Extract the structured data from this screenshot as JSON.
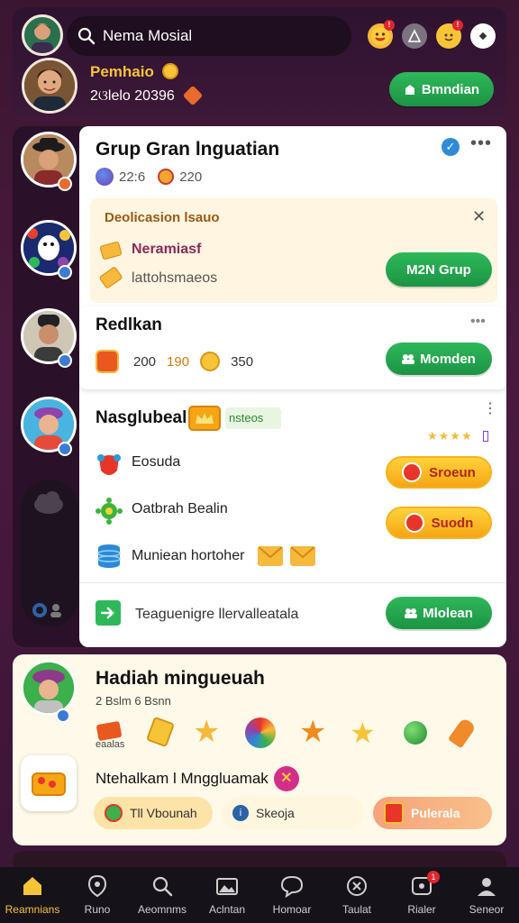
{
  "header": {
    "search_text": "Nema Mosial",
    "profile_name": "Pemhaio",
    "profile_stats": "2ଓlelo 20396",
    "button_label": "Bmndian"
  },
  "group": {
    "title": "Grup Gran lnguatian",
    "stats_a": "22:6",
    "stats_b": "220",
    "notice": {
      "title": "Deolicasion lsauo",
      "item1": "Neramiasf",
      "item2": "lattohsmaeos",
      "button": "M2N Grup"
    },
    "redeem": {
      "title": "Redlkan",
      "val_a": "200",
      "val_b": "190",
      "val_c": "350",
      "button": "Momden"
    },
    "section": {
      "title": "Nasglubeal",
      "tag": "nsteos",
      "items": [
        {
          "label": "Eosuda",
          "button": "Sroeun"
        },
        {
          "label": "Oatbrah Bealin",
          "button": "Suodn"
        },
        {
          "label": "Muniean hortoher"
        }
      ],
      "footer_text": "Teaguenigre llervalleatala",
      "footer_button": "Mlolean"
    }
  },
  "reward": {
    "title": "Hadiah mingueuah",
    "subtitle": "2 Bslm 6 Bsnn",
    "item_label": "eaalas",
    "promo_text": "Ntehalkam l Mnggluamak",
    "pills": [
      "Tll Vbounah",
      "Skeoja",
      "Pulerala"
    ]
  },
  "nav": [
    {
      "label": "Reamnians",
      "icon": "home-icon",
      "active": true
    },
    {
      "label": "Runo",
      "icon": "location-icon"
    },
    {
      "label": "Aeomnms",
      "icon": "search-icon"
    },
    {
      "label": "Aclntan",
      "icon": "mountain-icon"
    },
    {
      "label": "Homoar",
      "icon": "chat-icon"
    },
    {
      "label": "Taulat",
      "icon": "scan-icon"
    },
    {
      "label": "Rialer",
      "icon": "message-icon",
      "badge": "1"
    },
    {
      "label": "Seneor",
      "icon": "profile-icon"
    }
  ],
  "colors": {
    "accent": "#f6c437",
    "green": "#1b9444",
    "orange": "#f6a515",
    "bg": "#3b1631"
  }
}
